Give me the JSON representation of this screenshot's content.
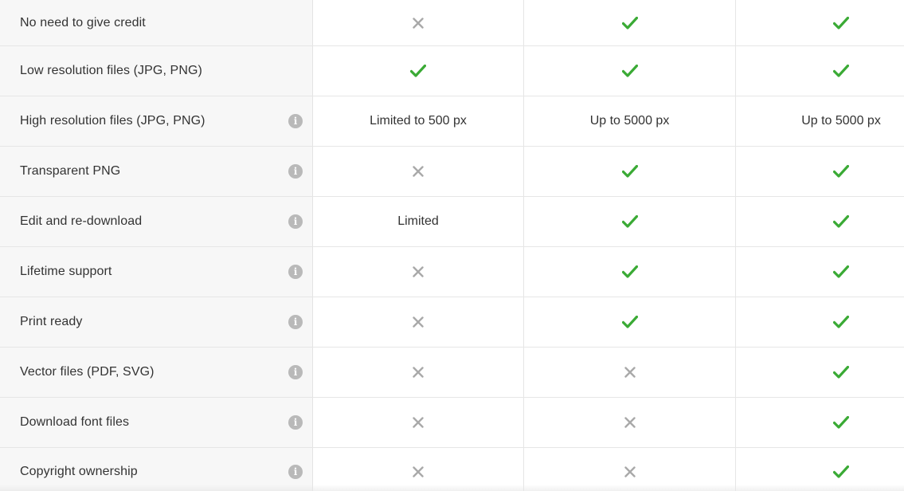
{
  "colors": {
    "check": "#3aaa35",
    "cross": "#a9a9a9",
    "info": "#b9b9b9"
  },
  "rows": [
    {
      "label": "No need to give credit",
      "info": false,
      "cells": [
        {
          "type": "cross"
        },
        {
          "type": "check"
        },
        {
          "type": "check"
        }
      ]
    },
    {
      "label": "Low resolution files (JPG, PNG)",
      "info": false,
      "cells": [
        {
          "type": "check"
        },
        {
          "type": "check"
        },
        {
          "type": "check"
        }
      ]
    },
    {
      "label": "High resolution files (JPG, PNG)",
      "info": true,
      "cells": [
        {
          "type": "text",
          "text": "Limited to 500 px"
        },
        {
          "type": "text",
          "text": "Up to 5000 px"
        },
        {
          "type": "text",
          "text": "Up to 5000 px"
        }
      ]
    },
    {
      "label": "Transparent PNG",
      "info": true,
      "cells": [
        {
          "type": "cross"
        },
        {
          "type": "check"
        },
        {
          "type": "check"
        }
      ]
    },
    {
      "label": "Edit and re-download",
      "info": true,
      "cells": [
        {
          "type": "text",
          "text": "Limited"
        },
        {
          "type": "check"
        },
        {
          "type": "check"
        }
      ]
    },
    {
      "label": "Lifetime support",
      "info": true,
      "cells": [
        {
          "type": "cross"
        },
        {
          "type": "check"
        },
        {
          "type": "check"
        }
      ]
    },
    {
      "label": "Print ready",
      "info": true,
      "cells": [
        {
          "type": "cross"
        },
        {
          "type": "check"
        },
        {
          "type": "check"
        }
      ]
    },
    {
      "label": "Vector files (PDF, SVG)",
      "info": true,
      "cells": [
        {
          "type": "cross"
        },
        {
          "type": "cross"
        },
        {
          "type": "check"
        }
      ]
    },
    {
      "label": "Download font files",
      "info": true,
      "cells": [
        {
          "type": "cross"
        },
        {
          "type": "cross"
        },
        {
          "type": "check"
        }
      ]
    },
    {
      "label": "Copyright ownership",
      "info": true,
      "cells": [
        {
          "type": "cross"
        },
        {
          "type": "cross"
        },
        {
          "type": "check"
        }
      ]
    }
  ],
  "icons": {
    "info": "info-icon",
    "check": "check-icon",
    "cross": "cross-icon"
  },
  "info_glyph": "i"
}
